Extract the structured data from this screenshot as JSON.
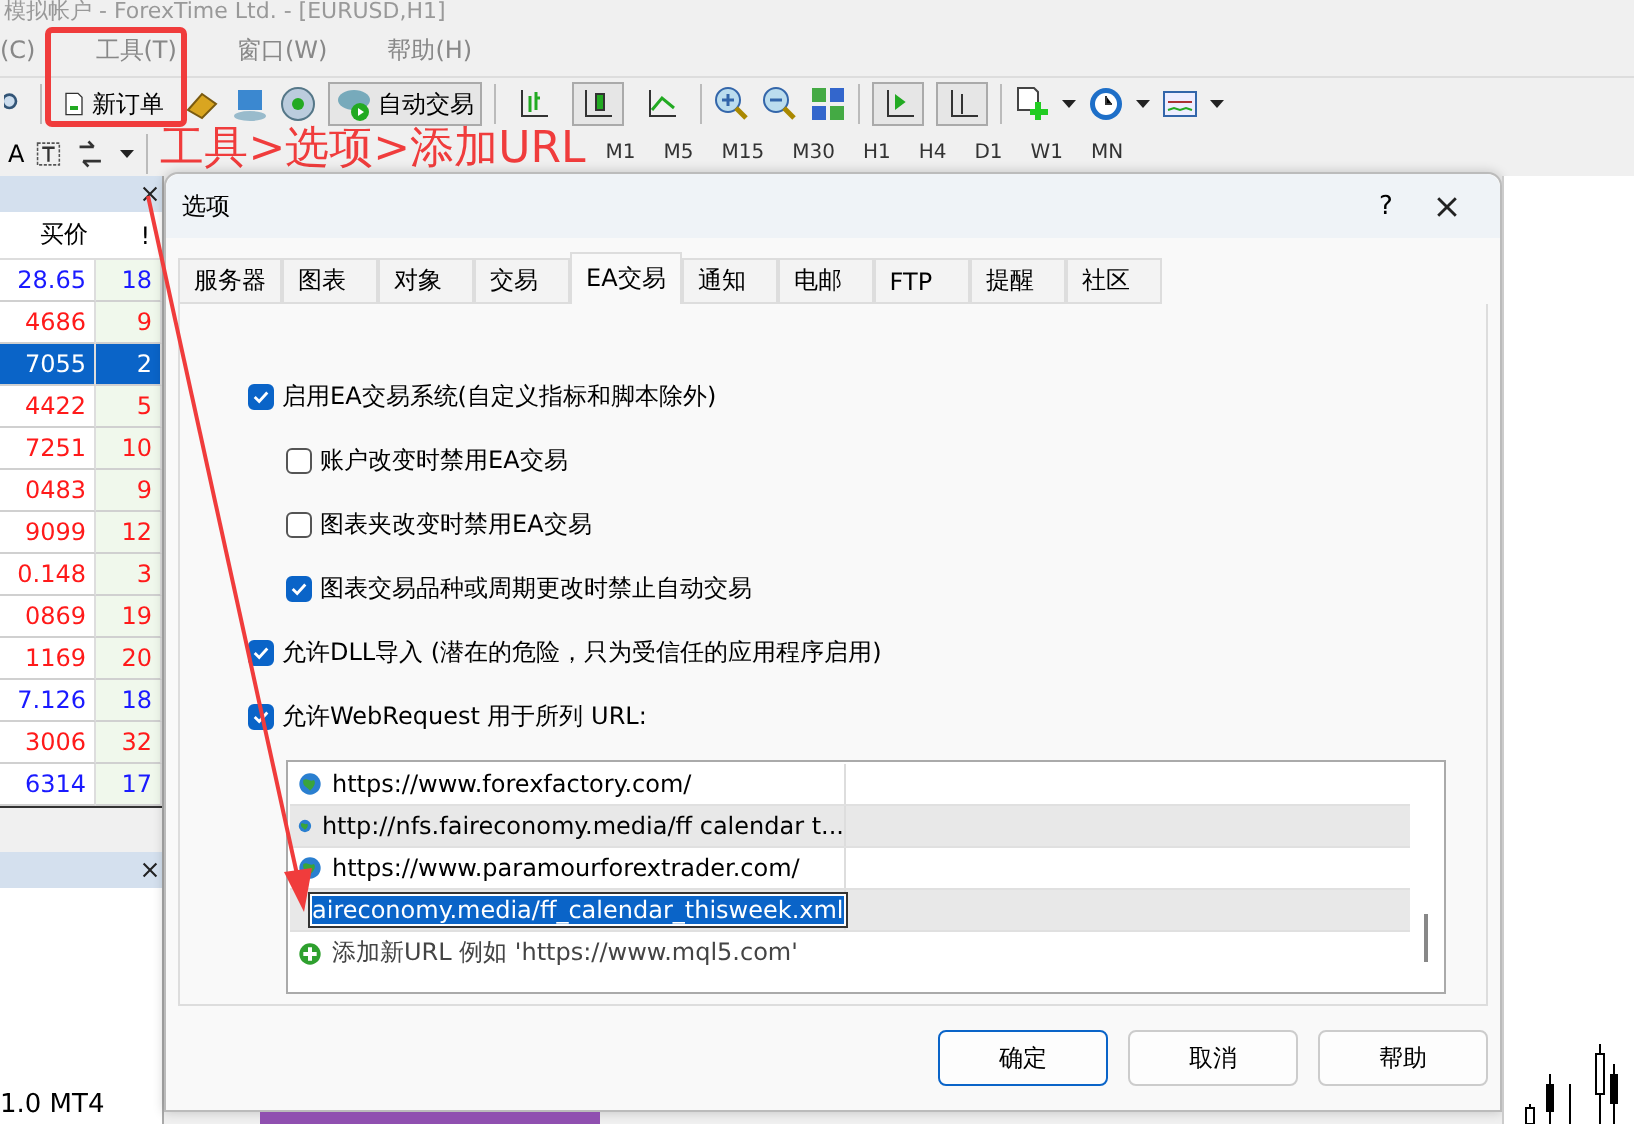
{
  "window": {
    "title": "模拟帐户 - ForexTime Ltd. - [EURUSD,H1]"
  },
  "menu": [
    {
      "label": "(C)"
    },
    {
      "label": "工具(T)"
    },
    {
      "label": "窗口(W)"
    },
    {
      "label": "帮助(H)"
    }
  ],
  "toolbar": {
    "new_order_label": "新订单",
    "auto_trade_label": "自动交易",
    "chart_types": [
      {
        "selected": false
      },
      {
        "selected": true
      },
      {
        "selected": false
      }
    ],
    "scroll_toggles": [
      {
        "on": true
      },
      {
        "on": true
      }
    ]
  },
  "toolbar2": {
    "font_label": "A",
    "timeframes": [
      "M1",
      "M5",
      "M15",
      "M30",
      "H1",
      "H4",
      "D1",
      "W1",
      "MN"
    ]
  },
  "annotation": {
    "label": "工具>选项>添加URL"
  },
  "market_watch": {
    "columns": [
      "买价",
      "!"
    ],
    "rows": [
      {
        "bid": "28.65",
        "spread": "18",
        "color": "#1a1aff",
        "selected": false
      },
      {
        "bid": "4686",
        "spread": "9",
        "color": "#ff1a1a",
        "selected": false
      },
      {
        "bid": "7055",
        "spread": "2",
        "selected": true
      },
      {
        "bid": "4422",
        "spread": "5",
        "color": "#ff1a1a",
        "selected": false
      },
      {
        "bid": "7251",
        "spread": "10",
        "color": "#ff1a1a",
        "selected": false
      },
      {
        "bid": "0483",
        "spread": "9",
        "color": "#ff1a1a",
        "selected": false
      },
      {
        "bid": "9099",
        "spread": "12",
        "color": "#ff1a1a",
        "selected": false
      },
      {
        "bid": "0.148",
        "spread": "3",
        "color": "#ff1a1a",
        "selected": false
      },
      {
        "bid": "0869",
        "spread": "19",
        "color": "#ff1a1a",
        "selected": false
      },
      {
        "bid": "1169",
        "spread": "20",
        "color": "#ff1a1a",
        "selected": false
      },
      {
        "bid": "7.126",
        "spread": "18",
        "color": "#1a1aff",
        "selected": false
      },
      {
        "bid": "3006",
        "spread": "32",
        "color": "#ff1a1a",
        "selected": false
      },
      {
        "bid": "6314",
        "spread": "17",
        "color": "#1a1aff",
        "selected": false
      }
    ]
  },
  "lower_panel": {
    "text": "1.0 MT4"
  },
  "dialog": {
    "title": "选项",
    "help": "?",
    "tabs": [
      {
        "label": "服务器",
        "selected": false
      },
      {
        "label": "图表",
        "selected": false
      },
      {
        "label": "对象",
        "selected": false
      },
      {
        "label": "交易",
        "selected": false
      },
      {
        "label": "EA交易",
        "selected": true
      },
      {
        "label": "通知",
        "selected": false
      },
      {
        "label": "电邮",
        "selected": false
      },
      {
        "label": "FTP",
        "selected": false
      },
      {
        "label": "提醒",
        "selected": false
      },
      {
        "label": "社区",
        "selected": false
      }
    ],
    "options": [
      {
        "label": "启用EA交易系统(自定义指标和脚本除外)",
        "checked": true,
        "children": [
          {
            "label": "账户改变时禁用EA交易",
            "checked": false
          },
          {
            "label": "图表夹改变时禁用EA交易",
            "checked": false
          },
          {
            "label": "图表交易品种或周期更改时禁止自动交易",
            "checked": true
          }
        ]
      },
      {
        "label": "允许DLL导入 (潜在的危险，只为受信任的应用程序启用)",
        "checked": true
      },
      {
        "label": "允许WebRequest 用于所列 URL:",
        "checked": true
      }
    ],
    "urls": [
      {
        "url": "https://www.forexfactory.com/",
        "editing": false
      },
      {
        "url": "http://nfs.faireconomy.media/ff calendar t...",
        "editing": false
      },
      {
        "url": "https://www.paramourforextrader.com/",
        "editing": false
      },
      {
        "url": "aireconomy.media/ff_calendar_thisweek.xml",
        "editing": true
      }
    ],
    "add_url": "添加新URL 例如 'https://www.mql5.com'",
    "buttons": [
      {
        "label": "确定",
        "default": true
      },
      {
        "label": "取消",
        "default": false
      },
      {
        "label": "帮助",
        "default": false
      }
    ]
  }
}
